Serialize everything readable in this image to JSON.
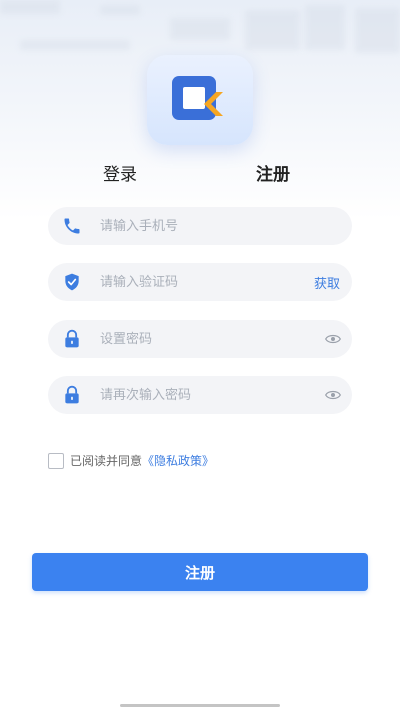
{
  "tabs": {
    "login_label": "登录",
    "register_label": "注册"
  },
  "form": {
    "phone_placeholder": "请输入手机号",
    "code_placeholder": "请输入验证码",
    "get_code_label": "获取",
    "password_placeholder": "设置密码",
    "confirm_password_placeholder": "请再次输入密码"
  },
  "agreement": {
    "text": "已阅读并同意",
    "policy_link": "《隐私政策》",
    "checked": false
  },
  "submit_label": "注册",
  "colors": {
    "accent": "#3b82f0",
    "icon_blue": "#3d7de0",
    "logo_orange": "#f5a623"
  }
}
